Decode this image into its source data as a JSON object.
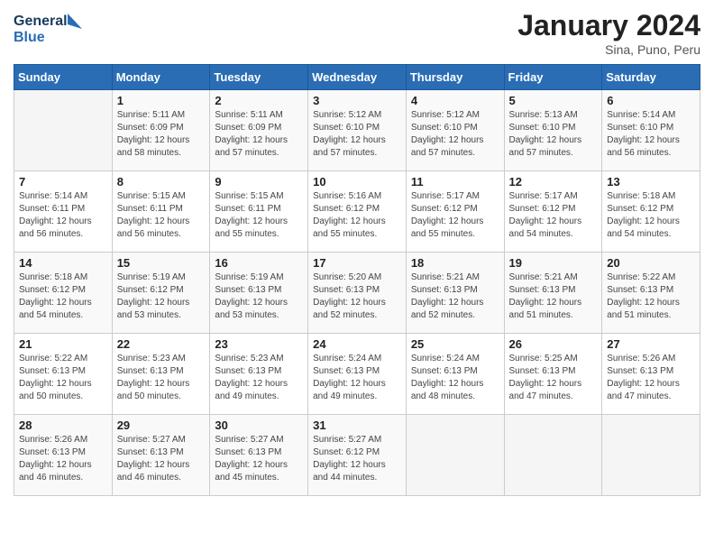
{
  "header": {
    "logo_general": "General",
    "logo_blue": "Blue",
    "month_title": "January 2024",
    "subtitle": "Sina, Puno, Peru"
  },
  "weekdays": [
    "Sunday",
    "Monday",
    "Tuesday",
    "Wednesday",
    "Thursday",
    "Friday",
    "Saturday"
  ],
  "weeks": [
    [
      {
        "day": "",
        "info": ""
      },
      {
        "day": "1",
        "info": "Sunrise: 5:11 AM\nSunset: 6:09 PM\nDaylight: 12 hours\nand 58 minutes."
      },
      {
        "day": "2",
        "info": "Sunrise: 5:11 AM\nSunset: 6:09 PM\nDaylight: 12 hours\nand 57 minutes."
      },
      {
        "day": "3",
        "info": "Sunrise: 5:12 AM\nSunset: 6:10 PM\nDaylight: 12 hours\nand 57 minutes."
      },
      {
        "day": "4",
        "info": "Sunrise: 5:12 AM\nSunset: 6:10 PM\nDaylight: 12 hours\nand 57 minutes."
      },
      {
        "day": "5",
        "info": "Sunrise: 5:13 AM\nSunset: 6:10 PM\nDaylight: 12 hours\nand 57 minutes."
      },
      {
        "day": "6",
        "info": "Sunrise: 5:14 AM\nSunset: 6:10 PM\nDaylight: 12 hours\nand 56 minutes."
      }
    ],
    [
      {
        "day": "7",
        "info": "Sunrise: 5:14 AM\nSunset: 6:11 PM\nDaylight: 12 hours\nand 56 minutes."
      },
      {
        "day": "8",
        "info": "Sunrise: 5:15 AM\nSunset: 6:11 PM\nDaylight: 12 hours\nand 56 minutes."
      },
      {
        "day": "9",
        "info": "Sunrise: 5:15 AM\nSunset: 6:11 PM\nDaylight: 12 hours\nand 55 minutes."
      },
      {
        "day": "10",
        "info": "Sunrise: 5:16 AM\nSunset: 6:12 PM\nDaylight: 12 hours\nand 55 minutes."
      },
      {
        "day": "11",
        "info": "Sunrise: 5:17 AM\nSunset: 6:12 PM\nDaylight: 12 hours\nand 55 minutes."
      },
      {
        "day": "12",
        "info": "Sunrise: 5:17 AM\nSunset: 6:12 PM\nDaylight: 12 hours\nand 54 minutes."
      },
      {
        "day": "13",
        "info": "Sunrise: 5:18 AM\nSunset: 6:12 PM\nDaylight: 12 hours\nand 54 minutes."
      }
    ],
    [
      {
        "day": "14",
        "info": "Sunrise: 5:18 AM\nSunset: 6:12 PM\nDaylight: 12 hours\nand 54 minutes."
      },
      {
        "day": "15",
        "info": "Sunrise: 5:19 AM\nSunset: 6:12 PM\nDaylight: 12 hours\nand 53 minutes."
      },
      {
        "day": "16",
        "info": "Sunrise: 5:19 AM\nSunset: 6:13 PM\nDaylight: 12 hours\nand 53 minutes."
      },
      {
        "day": "17",
        "info": "Sunrise: 5:20 AM\nSunset: 6:13 PM\nDaylight: 12 hours\nand 52 minutes."
      },
      {
        "day": "18",
        "info": "Sunrise: 5:21 AM\nSunset: 6:13 PM\nDaylight: 12 hours\nand 52 minutes."
      },
      {
        "day": "19",
        "info": "Sunrise: 5:21 AM\nSunset: 6:13 PM\nDaylight: 12 hours\nand 51 minutes."
      },
      {
        "day": "20",
        "info": "Sunrise: 5:22 AM\nSunset: 6:13 PM\nDaylight: 12 hours\nand 51 minutes."
      }
    ],
    [
      {
        "day": "21",
        "info": "Sunrise: 5:22 AM\nSunset: 6:13 PM\nDaylight: 12 hours\nand 50 minutes."
      },
      {
        "day": "22",
        "info": "Sunrise: 5:23 AM\nSunset: 6:13 PM\nDaylight: 12 hours\nand 50 minutes."
      },
      {
        "day": "23",
        "info": "Sunrise: 5:23 AM\nSunset: 6:13 PM\nDaylight: 12 hours\nand 49 minutes."
      },
      {
        "day": "24",
        "info": "Sunrise: 5:24 AM\nSunset: 6:13 PM\nDaylight: 12 hours\nand 49 minutes."
      },
      {
        "day": "25",
        "info": "Sunrise: 5:24 AM\nSunset: 6:13 PM\nDaylight: 12 hours\nand 48 minutes."
      },
      {
        "day": "26",
        "info": "Sunrise: 5:25 AM\nSunset: 6:13 PM\nDaylight: 12 hours\nand 47 minutes."
      },
      {
        "day": "27",
        "info": "Sunrise: 5:26 AM\nSunset: 6:13 PM\nDaylight: 12 hours\nand 47 minutes."
      }
    ],
    [
      {
        "day": "28",
        "info": "Sunrise: 5:26 AM\nSunset: 6:13 PM\nDaylight: 12 hours\nand 46 minutes."
      },
      {
        "day": "29",
        "info": "Sunrise: 5:27 AM\nSunset: 6:13 PM\nDaylight: 12 hours\nand 46 minutes."
      },
      {
        "day": "30",
        "info": "Sunrise: 5:27 AM\nSunset: 6:13 PM\nDaylight: 12 hours\nand 45 minutes."
      },
      {
        "day": "31",
        "info": "Sunrise: 5:27 AM\nSunset: 6:12 PM\nDaylight: 12 hours\nand 44 minutes."
      },
      {
        "day": "",
        "info": ""
      },
      {
        "day": "",
        "info": ""
      },
      {
        "day": "",
        "info": ""
      }
    ]
  ]
}
